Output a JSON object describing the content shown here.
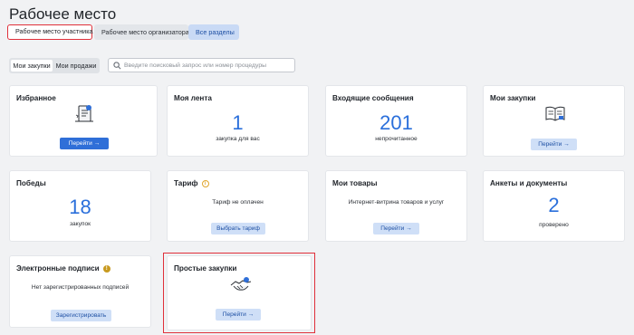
{
  "page": {
    "title": "Рабочее место"
  },
  "role_tabs": [
    {
      "label": "Рабочее место участника",
      "active": true
    },
    {
      "label": "Рабочее место организатора",
      "active": false
    },
    {
      "label": "Все разделы",
      "active": false
    }
  ],
  "segment": {
    "mine": "Мои закупки",
    "sales": "Мои продажи"
  },
  "search": {
    "placeholder": "Введите поисковый запрос или номер процедуры",
    "value": "",
    "icon": "search-icon"
  },
  "cards": {
    "favorites": {
      "title": "Избранное",
      "button": "Перейти →",
      "icon": "favorites-document-icon"
    },
    "feed": {
      "title": "Моя лента",
      "number": "1",
      "caption": "закупка для вас"
    },
    "messages": {
      "title": "Входящие сообщения",
      "number": "201",
      "caption": "непрочитанное"
    },
    "my_purchases": {
      "title": "Мои закупки",
      "button": "Перейти →",
      "icon": "book-icon"
    },
    "wins": {
      "title": "Победы",
      "number": "18",
      "caption": "закупок"
    },
    "tariff": {
      "title": "Тариф",
      "caption": "Тариф не оплачен",
      "button": "Выбрать тариф",
      "badge": "i"
    },
    "goods": {
      "title": "Мои товары",
      "caption": "Интернет-витрина товаров и услуг",
      "button": "Перейти →"
    },
    "forms": {
      "title": "Анкеты и документы",
      "number": "2",
      "caption": "проверено"
    },
    "signatures": {
      "title": "Электронные подписи",
      "caption": "Нет зарегистрированных подписей",
      "button": "Зарегистрировать",
      "badge": "!"
    },
    "simple": {
      "title": "Простые закупки",
      "button": "Перейти →",
      "icon": "handshake-icon"
    }
  },
  "colors": {
    "accent": "#2f6fd8",
    "number": "#2a6fdb",
    "highlight": "#e0303a",
    "light_button": "#cfdff7"
  }
}
